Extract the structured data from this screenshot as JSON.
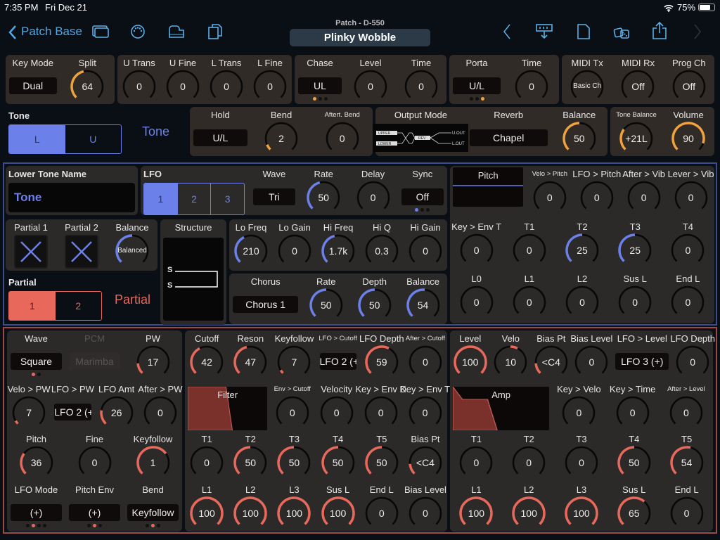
{
  "status": {
    "time": "7:35 PM",
    "date": "Fri Dec 21",
    "battery": "75%"
  },
  "nav": {
    "back": "Patch Base",
    "subtitle": "Patch - D-550",
    "patch_name": "Plinky Wobble"
  },
  "colors": {
    "top": "#f0a23c",
    "tone": "#6b80e8",
    "partial": "#e8695c"
  },
  "tone_selector": {
    "label": "Tone",
    "options": [
      "L",
      "U"
    ],
    "active": 0,
    "big_label": "Tone"
  },
  "partial_selector": {
    "label": "Partial",
    "options": [
      "1",
      "2"
    ],
    "active": 0,
    "big_label": "Partial"
  },
  "tone_name": {
    "label": "Lower Tone Name",
    "value": "Tone"
  },
  "structure": {
    "label": "Structure",
    "s1": "S",
    "s2": "S"
  },
  "output_mode": {
    "upper": "UPPER",
    "lower": "LOWER",
    "rev": "REV",
    "uout": "U.OUT",
    "lout": "L.OUT"
  },
  "panels": {
    "keymode": {
      "rows": [
        [
          {
            "t": "select",
            "label": "Key Mode",
            "value": "Dual"
          },
          {
            "t": "knob",
            "label": "Split",
            "value": "64",
            "fill": 0.45
          }
        ]
      ]
    },
    "trans": {
      "rows": [
        [
          {
            "t": "knob",
            "label": "U Trans",
            "value": "0",
            "fill": 0
          },
          {
            "t": "knob",
            "label": "U Fine",
            "value": "0",
            "fill": 0
          },
          {
            "t": "knob",
            "label": "L Trans",
            "value": "0",
            "fill": 0
          },
          {
            "t": "knob",
            "label": "L Fine",
            "value": "0",
            "fill": 0
          }
        ]
      ]
    },
    "chase": {
      "rows": [
        [
          {
            "t": "select",
            "label": "Chase",
            "value": "UL",
            "dots": 3,
            "active": 0
          },
          {
            "t": "knob",
            "label": "Level",
            "value": "0",
            "fill": 0
          },
          {
            "t": "knob",
            "label": "Time",
            "value": "0",
            "fill": 0
          }
        ]
      ]
    },
    "porta": {
      "rows": [
        [
          {
            "t": "select",
            "label": "Porta",
            "value": "U/L",
            "dots": 3,
            "active": 2
          },
          {
            "t": "knob",
            "label": "Time",
            "value": "0",
            "fill": 0
          }
        ]
      ]
    },
    "midi": {
      "rows": [
        [
          {
            "t": "knob",
            "label": "MIDI Tx",
            "value": "Basic Ch",
            "fill": 0
          },
          {
            "t": "knob",
            "label": "MIDI Rx",
            "value": "Off",
            "fill": 0
          },
          {
            "t": "knob",
            "label": "Prog Ch",
            "value": "Off",
            "fill": 0
          }
        ]
      ]
    },
    "hold": {
      "rows": [
        [
          {
            "t": "select",
            "label": "Hold",
            "value": "U/L"
          },
          {
            "t": "knob",
            "label": "Bend",
            "value": "2",
            "fill": 0.08
          },
          {
            "t": "knob",
            "label": "Aftert. Bend",
            "value": "0",
            "fill": 0
          }
        ]
      ]
    },
    "output": {
      "rows": [
        [
          {
            "t": "outmode",
            "label": "Output Mode"
          },
          {
            "t": "select",
            "label": "Reverb",
            "value": "Chapel",
            "wide": true
          },
          {
            "t": "knob",
            "label": "Balance",
            "value": "50",
            "fill": 0.5
          }
        ]
      ]
    },
    "volume": {
      "rows": [
        [
          {
            "t": "knob",
            "label": "Tone Balance",
            "value": "+21L",
            "fill": 0.3
          },
          {
            "t": "knob",
            "label": "Volume",
            "value": "90",
            "fill": 0.9
          }
        ]
      ]
    },
    "lfo": {
      "rows": [
        [
          {
            "t": "seg",
            "label": "LFO",
            "options": [
              "1",
              "2",
              "3"
            ],
            "active": 0
          },
          {
            "t": "select",
            "label": "Wave",
            "value": "Tri"
          },
          {
            "t": "knob",
            "label": "Rate",
            "value": "50",
            "fill": 0.45
          },
          {
            "t": "knob",
            "label": "Delay",
            "value": "0",
            "fill": 0
          },
          {
            "t": "select",
            "label": "Sync",
            "value": "Off",
            "dots": 3,
            "active": 0
          }
        ]
      ]
    },
    "partials": {
      "rows": [
        [
          {
            "t": "xbox",
            "label": "Partial 1"
          },
          {
            "t": "xbox",
            "label": "Partial 2"
          },
          {
            "t": "knob",
            "label": "Balance",
            "value": "Balanced",
            "fill": 0.5
          }
        ]
      ]
    },
    "eq": {
      "rows": [
        [
          {
            "t": "knob",
            "label": "Lo Freq",
            "value": "210",
            "fill": 0.4
          },
          {
            "t": "knob",
            "label": "Lo Gain",
            "value": "0",
            "fill": 0
          },
          {
            "t": "knob",
            "label": "Hi Freq",
            "value": "1.7k",
            "fill": 0.45
          },
          {
            "t": "knob",
            "label": "Hi Q",
            "value": "0.3",
            "fill": 0
          },
          {
            "t": "knob",
            "label": "Hi Gain",
            "value": "0",
            "fill": 0
          }
        ]
      ]
    },
    "chorus": {
      "rows": [
        [
          {
            "t": "select",
            "label": "Chorus",
            "value": "Chorus 1",
            "wide": true
          },
          {
            "t": "knob",
            "label": "Rate",
            "value": "50",
            "fill": 0.5
          },
          {
            "t": "knob",
            "label": "Depth",
            "value": "50",
            "fill": 0.5
          },
          {
            "t": "knob",
            "label": "Balance",
            "value": "54",
            "fill": 0.52
          }
        ]
      ]
    },
    "pitch": {
      "rows": [
        [
          {
            "t": "env",
            "label": "Pitch",
            "shape": "pitch"
          },
          {
            "t": "knob",
            "label": "Velo > Pitch",
            "value": "0",
            "fill": 0
          },
          {
            "t": "knob",
            "label": "LFO > Pitch",
            "value": "0",
            "fill": 0
          },
          {
            "t": "knob",
            "label": "After > Vib",
            "value": "0",
            "fill": 0
          },
          {
            "t": "knob",
            "label": "Lever > Vib",
            "value": "0",
            "fill": 0
          }
        ],
        [
          {
            "t": "knob",
            "label": "Key > Env T",
            "value": "0",
            "fill": 0
          },
          {
            "t": "knob",
            "label": "T1",
            "value": "0",
            "fill": 0
          },
          {
            "t": "knob",
            "label": "T2",
            "value": "25",
            "fill": 0.5
          },
          {
            "t": "knob",
            "label": "T3",
            "value": "25",
            "fill": 0.5
          },
          {
            "t": "knob",
            "label": "T4",
            "value": "0",
            "fill": 0
          }
        ],
        [
          {
            "t": "knob",
            "label": "L0",
            "value": "0",
            "fill": 0
          },
          {
            "t": "knob",
            "label": "L1",
            "value": "0",
            "fill": 0
          },
          {
            "t": "knob",
            "label": "L2",
            "value": "0",
            "fill": 0
          },
          {
            "t": "knob",
            "label": "Sus L",
            "value": "0",
            "fill": 0
          },
          {
            "t": "knob",
            "label": "End L",
            "value": "0",
            "fill": 0
          }
        ]
      ]
    },
    "wg": {
      "rows": [
        [
          {
            "t": "select",
            "label": "Wave",
            "value": "Square",
            "dots": 2,
            "active": 0
          },
          {
            "t": "select",
            "label": "PCM",
            "value": "Marimba",
            "disabled": true
          },
          {
            "t": "knob",
            "label": "PW",
            "value": "17",
            "fill": 0.15
          }
        ],
        [
          {
            "t": "knob",
            "label": "Velo > PW",
            "value": "7",
            "fill": 0.05
          },
          {
            "t": "select",
            "label": "LFO > PW",
            "value": "LFO 2 (+)"
          },
          {
            "t": "knob",
            "label": "LFO Amt",
            "value": "26",
            "fill": 0.2
          },
          {
            "t": "knob",
            "label": "After > PW",
            "value": "0",
            "fill": 0
          }
        ],
        [
          {
            "t": "knob",
            "label": "Pitch",
            "value": "36",
            "fill": 0.3
          },
          {
            "t": "knob",
            "label": "Fine",
            "value": "0",
            "fill": 0
          },
          {
            "t": "knob",
            "label": "Keyfollow",
            "value": "1",
            "fill": 0.7
          }
        ],
        [
          {
            "t": "select",
            "label": "LFO Mode",
            "value": "(+)",
            "dots": 4,
            "active": 1
          },
          {
            "t": "select",
            "label": "Pitch Env",
            "value": "(+)",
            "dots": 3,
            "active": 1
          },
          {
            "t": "select",
            "label": "Bend",
            "value": "Keyfollow",
            "dots": 3,
            "active": 1
          }
        ]
      ]
    },
    "filter": {
      "rows": [
        [
          {
            "t": "knob",
            "label": "Cutoff",
            "value": "42",
            "fill": 0.4
          },
          {
            "t": "knob",
            "label": "Reson",
            "value": "47",
            "fill": 0.45
          },
          {
            "t": "knob",
            "label": "Keyfollow",
            "value": "7",
            "fill": 0.05
          },
          {
            "t": "select",
            "label": "LFO > Cutoff",
            "value": "LFO 2 (+)"
          },
          {
            "t": "knob",
            "label": "LFO Depth",
            "value": "59",
            "fill": 0.6
          },
          {
            "t": "knob",
            "label": "After > Cutoff",
            "value": "0",
            "fill": 0
          }
        ],
        [
          {
            "t": "env",
            "label": "Filter",
            "shape": "filter"
          },
          {
            "t": "knob",
            "label": "Env > Cutoff",
            "value": "0",
            "fill": 0
          },
          {
            "t": "knob",
            "label": "Velocity",
            "value": "0",
            "fill": 0
          },
          {
            "t": "knob",
            "label": "Key > Env D",
            "value": "0",
            "fill": 0
          },
          {
            "t": "knob",
            "label": "Key > Env T",
            "value": "0",
            "fill": 0
          }
        ],
        [
          {
            "t": "knob",
            "label": "T1",
            "value": "0",
            "fill": 0
          },
          {
            "t": "knob",
            "label": "T2",
            "value": "50",
            "fill": 0.5
          },
          {
            "t": "knob",
            "label": "T3",
            "value": "50",
            "fill": 0.5
          },
          {
            "t": "knob",
            "label": "T4",
            "value": "50",
            "fill": 0.5
          },
          {
            "t": "knob",
            "label": "T5",
            "value": "50",
            "fill": 0.5
          },
          {
            "t": "knob",
            "label": "Bias Pt",
            "value": "<C4",
            "fill": 0.15
          }
        ],
        [
          {
            "t": "knob",
            "label": "L1",
            "value": "100",
            "fill": 1
          },
          {
            "t": "knob",
            "label": "L2",
            "value": "100",
            "fill": 1
          },
          {
            "t": "knob",
            "label": "L3",
            "value": "100",
            "fill": 1
          },
          {
            "t": "knob",
            "label": "Sus L",
            "value": "100",
            "fill": 1
          },
          {
            "t": "knob",
            "label": "End L",
            "value": "0",
            "fill": 0
          },
          {
            "t": "knob",
            "label": "Bias Level",
            "value": "0",
            "fill": 0
          }
        ]
      ]
    },
    "amp": {
      "rows": [
        [
          {
            "t": "knob",
            "label": "Level",
            "value": "100",
            "fill": 1
          },
          {
            "t": "knob",
            "label": "Velo",
            "value": "10",
            "fill": 0.6,
            "from": 0.5
          },
          {
            "t": "knob",
            "label": "Bias Pt",
            "value": "<C4",
            "fill": 0.15
          },
          {
            "t": "knob",
            "label": "Bias Level",
            "value": "0",
            "fill": 0
          },
          {
            "t": "select",
            "label": "LFO > Level",
            "value": "LFO 3 (+)",
            "wide": true
          },
          {
            "t": "knob",
            "label": "LFO Depth",
            "value": "0",
            "fill": 0
          }
        ],
        [
          {
            "t": "env",
            "label": "Amp",
            "shape": "amp"
          },
          {
            "t": "knob",
            "label": "Key > Velo",
            "value": "0",
            "fill": 0
          },
          {
            "t": "knob",
            "label": "Key > Time",
            "value": "0",
            "fill": 0
          },
          {
            "t": "knob",
            "label": "After > Level",
            "value": "0",
            "fill": 0
          }
        ],
        [
          {
            "t": "knob",
            "label": "T1",
            "value": "0",
            "fill": 0
          },
          {
            "t": "knob",
            "label": "T2",
            "value": "0",
            "fill": 0
          },
          {
            "t": "knob",
            "label": "T3",
            "value": "0",
            "fill": 0
          },
          {
            "t": "knob",
            "label": "T4",
            "value": "50",
            "fill": 0.5
          },
          {
            "t": "knob",
            "label": "T5",
            "value": "54",
            "fill": 0.55
          }
        ],
        [
          {
            "t": "knob",
            "label": "L1",
            "value": "100",
            "fill": 1
          },
          {
            "t": "knob",
            "label": "L2",
            "value": "100",
            "fill": 1
          },
          {
            "t": "knob",
            "label": "L3",
            "value": "100",
            "fill": 1
          },
          {
            "t": "knob",
            "label": "Sus L",
            "value": "65",
            "fill": 0.65
          },
          {
            "t": "knob",
            "label": "End L",
            "value": "0",
            "fill": 0
          }
        ]
      ]
    }
  }
}
